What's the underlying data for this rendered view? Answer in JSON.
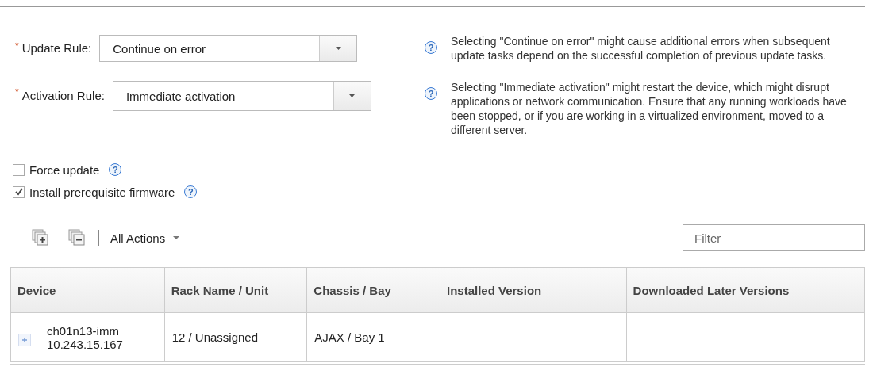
{
  "rules": [
    {
      "required_mark": "*",
      "label": "Update Rule:",
      "value": "Continue on error",
      "help_mark": "?",
      "help": "Selecting \"Continue on error\" might cause additional errors when subsequent update tasks depend on the successful completion of previous update tasks."
    },
    {
      "required_mark": "*",
      "label": "Activation Rule:",
      "value": "Immediate activation",
      "help_mark": "?",
      "help": "Selecting \"Immediate activation\" might restart the device, which might disrupt applications or network communication. Ensure that any running workloads have been stopped, or if you are working in a virtualized environment, moved to a different server."
    }
  ],
  "options": [
    {
      "label": "Force update",
      "checked": false,
      "help_mark": "?"
    },
    {
      "label": "Install prerequisite firmware",
      "checked": true,
      "help_mark": "?"
    }
  ],
  "toolbar": {
    "actions_label": "All Actions",
    "filter": {
      "placeholder": "Filter"
    }
  },
  "table": {
    "columns": [
      "Device",
      "Rack Name / Unit",
      "Chassis / Bay",
      "Installed Version",
      "Downloaded Later Versions"
    ],
    "rows": [
      {
        "expanded": false,
        "device": [
          "ch01n13-imm",
          "10.243.15.167"
        ],
        "rack": "12 / Unassigned",
        "chassis": "AJAX / Bay 1"
      }
    ]
  }
}
